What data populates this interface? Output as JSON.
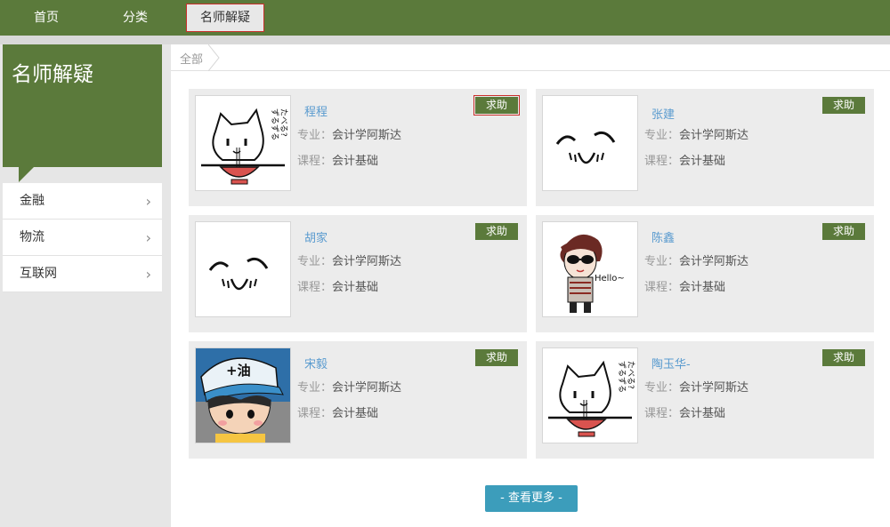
{
  "nav": {
    "home": "首页",
    "category": "分类",
    "qa": "名师解疑"
  },
  "sidebar": {
    "title": "名师解疑",
    "items": [
      {
        "label": "金融",
        "chevron": "›"
      },
      {
        "label": "物流",
        "chevron": "›"
      },
      {
        "label": "互联网",
        "chevron": "›"
      }
    ]
  },
  "breadcrumb": {
    "all": "全部"
  },
  "colors": {
    "brand_green": "#5b7a3b",
    "link_blue": "#5a9bcf",
    "more_button": "#3c9dbb"
  },
  "teachers": [
    {
      "name": "程程",
      "major_label": "专业：",
      "major": "会计学阿斯达",
      "course_label": "课程：",
      "course": "会计基础",
      "help": "求助",
      "avatar": "cat-noodle-avatar"
    },
    {
      "name": "张建",
      "major_label": "专业：",
      "major": "会计学阿斯达",
      "course_label": "课程：",
      "course": "会计基础",
      "help": "求助",
      "avatar": "sleepy-face-avatar"
    },
    {
      "name": "胡家",
      "major_label": "专业：",
      "major": "会计学阿斯达",
      "course_label": "课程：",
      "course": "会计基础",
      "help": "求助",
      "avatar": "sleepy-face-avatar"
    },
    {
      "name": "陈鑫",
      "major_label": "专业：",
      "major": "会计学阿斯达",
      "course_label": "课程：",
      "course": "会计基础",
      "help": "求助",
      "avatar": "sunglasses-hello-avatar",
      "avatar_text": "Hello~"
    },
    {
      "name": "宋毅",
      "major_label": "专业：",
      "major": "会计学阿斯达",
      "course_label": "课程：",
      "course": "会计基础",
      "help": "求助",
      "avatar": "cap-boy-avatar",
      "avatar_text": "+油"
    },
    {
      "name": "陶玉华-",
      "major_label": "专业：",
      "major": "会计学阿斯达",
      "course_label": "课程：",
      "course": "会计基础",
      "help": "求助",
      "avatar": "cat-noodle-avatar"
    }
  ],
  "more_button": "- 查看更多 -"
}
